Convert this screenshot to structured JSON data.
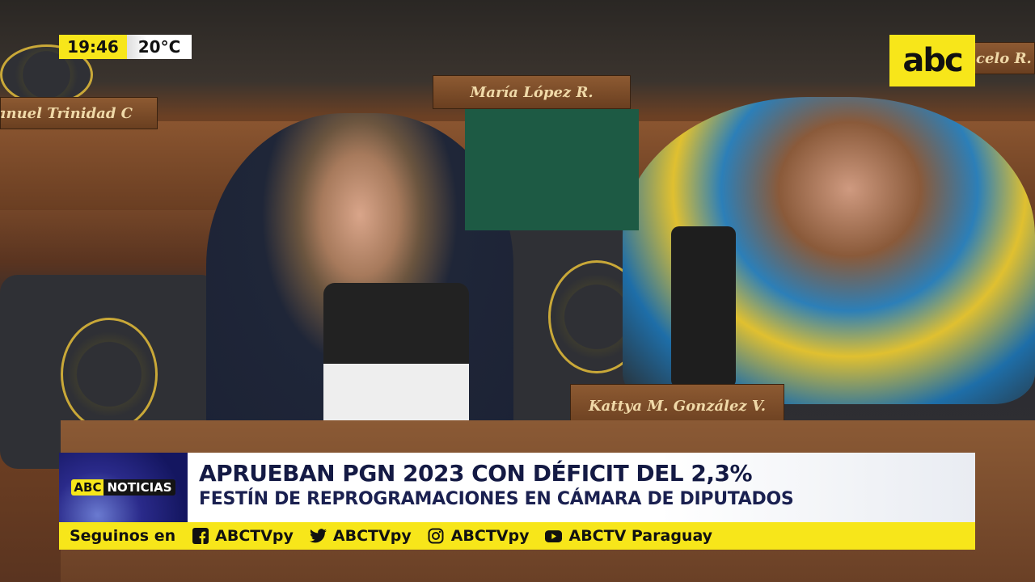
{
  "overlay": {
    "time": "19:46",
    "temperature": "20°C",
    "logo": "abc"
  },
  "scene": {
    "nameplates": [
      "anuel Trinidad C",
      "María López R.",
      "Kattya M. González V.",
      "celo R. S"
    ]
  },
  "lower_third": {
    "brand_abc": "ABC",
    "brand_noticias": "NOTICIAS",
    "headline": "APRUEBAN PGN 2023 CON DÉFICIT DEL 2,3%",
    "subheadline": "FESTÍN DE REPROGRAMACIONES EN CÁMARA DE DIPUTADOS"
  },
  "social": {
    "label": "Seguinos en",
    "items": [
      {
        "icon": "facebook-icon",
        "handle": "ABCTVpy"
      },
      {
        "icon": "twitter-icon",
        "handle": "ABCTVpy"
      },
      {
        "icon": "instagram-icon",
        "handle": "ABCTVpy"
      },
      {
        "icon": "youtube-icon",
        "handle": "ABCTV Paraguay"
      }
    ]
  },
  "colors": {
    "yellow": "#f7e61a",
    "navy": "#141a44"
  }
}
